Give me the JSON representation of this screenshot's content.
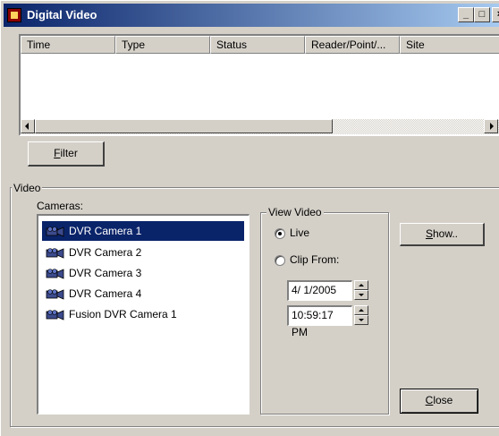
{
  "window": {
    "title": "Digital Video",
    "min_label": "_",
    "max_label": "□",
    "close_label": "×"
  },
  "events_list": {
    "columns": [
      "Time",
      "Type",
      "Status",
      "Reader/Point/...",
      "Site"
    ]
  },
  "filter_button": {
    "mnemonic": "F",
    "rest": "ilter"
  },
  "video_group": {
    "label": "Video",
    "cameras_label": "Cameras:",
    "cameras": [
      "DVR Camera 1",
      "DVR Camera 2",
      "DVR Camera 3",
      "DVR Camera 4",
      "Fusion DVR Camera 1"
    ],
    "selected_camera_index": 0
  },
  "view_video": {
    "label": "View Video",
    "live_label": "Live",
    "clip_label": "Clip From:",
    "selected": "Live",
    "date_value": "4/ 1/2005",
    "time_value": "10:59:17 PM"
  },
  "show_button": {
    "mnemonic": "S",
    "rest": "how.."
  },
  "close_button": {
    "mnemonic": "C",
    "rest": "lose"
  }
}
